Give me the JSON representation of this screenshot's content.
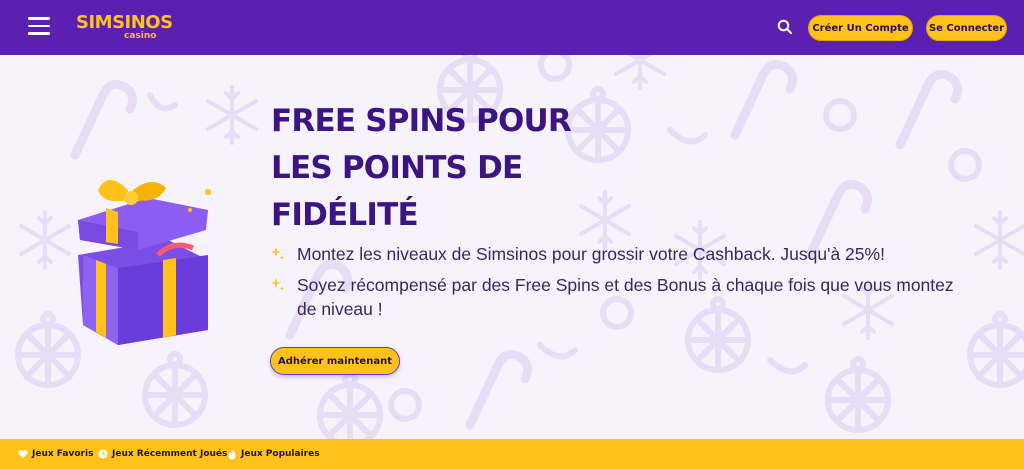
{
  "header": {
    "logo_text": "SIMSINOS",
    "logo_sub": "casino",
    "signup_label": "Créer Un Compte",
    "login_label": "Se Connecter"
  },
  "hero": {
    "title_lines": [
      "FREE SPINS POUR",
      "LES POINTS DE",
      "FIDÉLITÉ"
    ],
    "bullets": [
      "Montez les niveaux de Simsinos pour grossir votre Cashback. Jusqu'à 25%!",
      "Soyez récompensé par des Free Spins et des Bonus à chaque fois que vous montez de niveau !"
    ],
    "cta_label": "Adhérer maintenant"
  },
  "footer": {
    "items": [
      {
        "label": "Jeux Favoris",
        "icon": "heart-icon"
      },
      {
        "label": "Jeux Récemment Joués",
        "icon": "clock-icon"
      },
      {
        "label": "Jeux Populaires",
        "icon": "fire-icon"
      }
    ]
  },
  "colors": {
    "header_bg": "#5b1fb2",
    "accent_yellow": "#ffc21a",
    "title_purple": "#3c1582",
    "background": "#f7f3fc"
  }
}
